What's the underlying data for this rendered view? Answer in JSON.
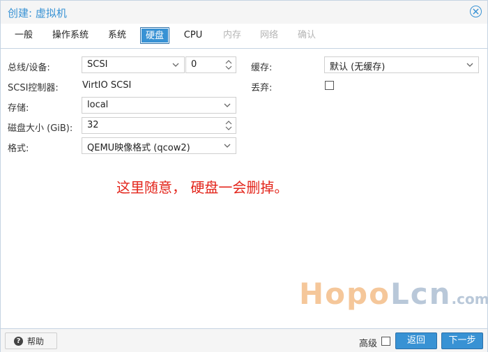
{
  "window": {
    "title": "创建: 虚拟机"
  },
  "tabs": [
    {
      "label": "一般",
      "state": "normal"
    },
    {
      "label": "操作系统",
      "state": "normal"
    },
    {
      "label": "系统",
      "state": "normal"
    },
    {
      "label": "硬盘",
      "state": "active"
    },
    {
      "label": "CPU",
      "state": "normal"
    },
    {
      "label": "内存",
      "state": "disabled"
    },
    {
      "label": "网络",
      "state": "disabled"
    },
    {
      "label": "确认",
      "state": "disabled"
    }
  ],
  "form": {
    "bus_label": "总线/设备:",
    "bus_value": "SCSI",
    "device_value": "0",
    "controller_label": "SCSI控制器:",
    "controller_value": "VirtIO SCSI",
    "storage_label": "存储:",
    "storage_value": "local",
    "size_label": "磁盘大小 (GiB):",
    "size_value": "32",
    "format_label": "格式:",
    "format_value": "QEMU映像格式 (qcow2)",
    "cache_label": "缓存:",
    "cache_value": "默认 (无缓存)",
    "discard_label": "丢弃:",
    "discard_checked": false
  },
  "annotation": "这里随意， 硬盘一会删掉。",
  "watermark": {
    "part1": "Hopo",
    "part2": "Lcn",
    "part3": ".com"
  },
  "footer": {
    "help_label": "帮助",
    "advanced_label": "高级",
    "advanced_checked": false,
    "back_label": "返回",
    "next_label": "下一步"
  },
  "colors": {
    "accent": "#3892d4",
    "annotation": "#e3261c"
  }
}
